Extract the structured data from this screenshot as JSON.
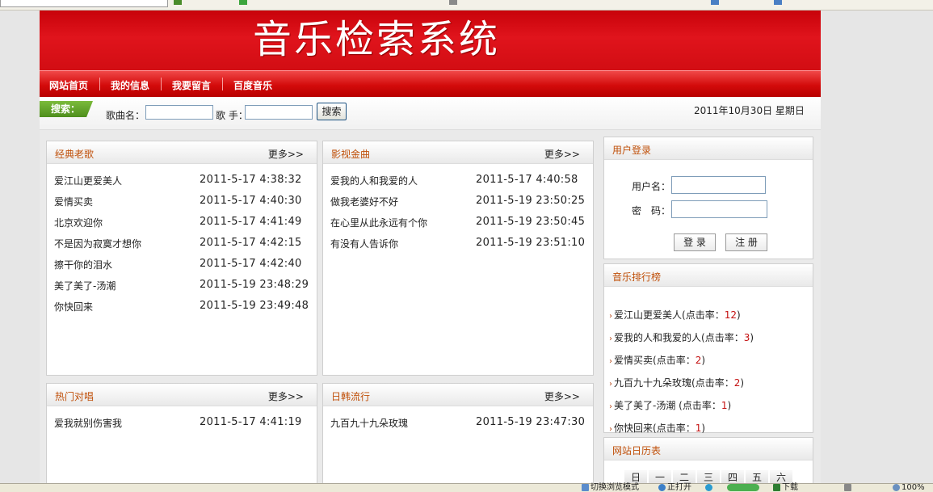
{
  "banner": {
    "title": "音乐检索系统"
  },
  "nav": {
    "items": [
      "网站首页",
      "我的信息",
      "我要留言",
      "百度音乐"
    ]
  },
  "search": {
    "tag": "搜索：",
    "song_label": "歌曲名：",
    "singer_label": "歌 手：",
    "button": "搜索"
  },
  "date": "2011年10月30日 星期日",
  "panels": {
    "classic": {
      "title": "经典老歌",
      "more": "更多>>",
      "rows": [
        {
          "title": "爱江山更爱美人",
          "date": "2011-5-17 4:38:32"
        },
        {
          "title": "爱情买卖",
          "date": "2011-5-17 4:40:30"
        },
        {
          "title": "北京欢迎你",
          "date": "2011-5-17 4:41:49"
        },
        {
          "title": "不是因为寂寞才想你",
          "date": "2011-5-17 4:42:15"
        },
        {
          "title": "擦干你的泪水",
          "date": "2011-5-17 4:42:40"
        },
        {
          "title": "美了美了-汤潮",
          "date": "2011-5-19 23:48:29"
        },
        {
          "title": "你快回来",
          "date": "2011-5-19 23:49:48"
        }
      ]
    },
    "film": {
      "title": "影视金曲",
      "more": "更多>>",
      "rows": [
        {
          "title": "爱我的人和我爱的人",
          "date": "2011-5-17 4:40:58"
        },
        {
          "title": "做我老婆好不好",
          "date": "2011-5-19 23:50:25"
        },
        {
          "title": "在心里从此永远有个你",
          "date": "2011-5-19 23:50:45"
        },
        {
          "title": "有没有人告诉你",
          "date": "2011-5-19 23:51:10"
        }
      ]
    },
    "duet": {
      "title": "热门对唱",
      "more": "更多>>",
      "rows": [
        {
          "title": "爱我就别伤害我",
          "date": "2011-5-17 4:41:19"
        }
      ]
    },
    "jk": {
      "title": "日韩流行",
      "more": "更多>>",
      "rows": [
        {
          "title": "九百九十九朵玫瑰",
          "date": "2011-5-19 23:47:30"
        }
      ]
    }
  },
  "login": {
    "title": "用户登录",
    "user_label": "用户名：",
    "pass_label": "密　码：",
    "login_button": "登 录",
    "register_button": "注 册"
  },
  "ranking": {
    "title": "音乐排行榜",
    "click_label": "(点击率：",
    "items": [
      {
        "name": "爱江山更爱美人",
        "count": "12"
      },
      {
        "name": "爱我的人和我爱的人",
        "count": "3"
      },
      {
        "name": "爱情买卖",
        "count": "2"
      },
      {
        "name": "九百九十九朵玫瑰",
        "count": "2"
      },
      {
        "name": "美了美了-汤潮 ",
        "count": "1"
      },
      {
        "name": "你快回来",
        "count": "1"
      }
    ]
  },
  "calendar": {
    "title": "网站日历表",
    "days": [
      "日",
      "一",
      "二",
      "三",
      "四",
      "五",
      "六"
    ]
  },
  "statusbar": {
    "browse_mode": "切换浏览模式",
    "opened": "正打开",
    "download": "下载",
    "zoom": "100%"
  }
}
